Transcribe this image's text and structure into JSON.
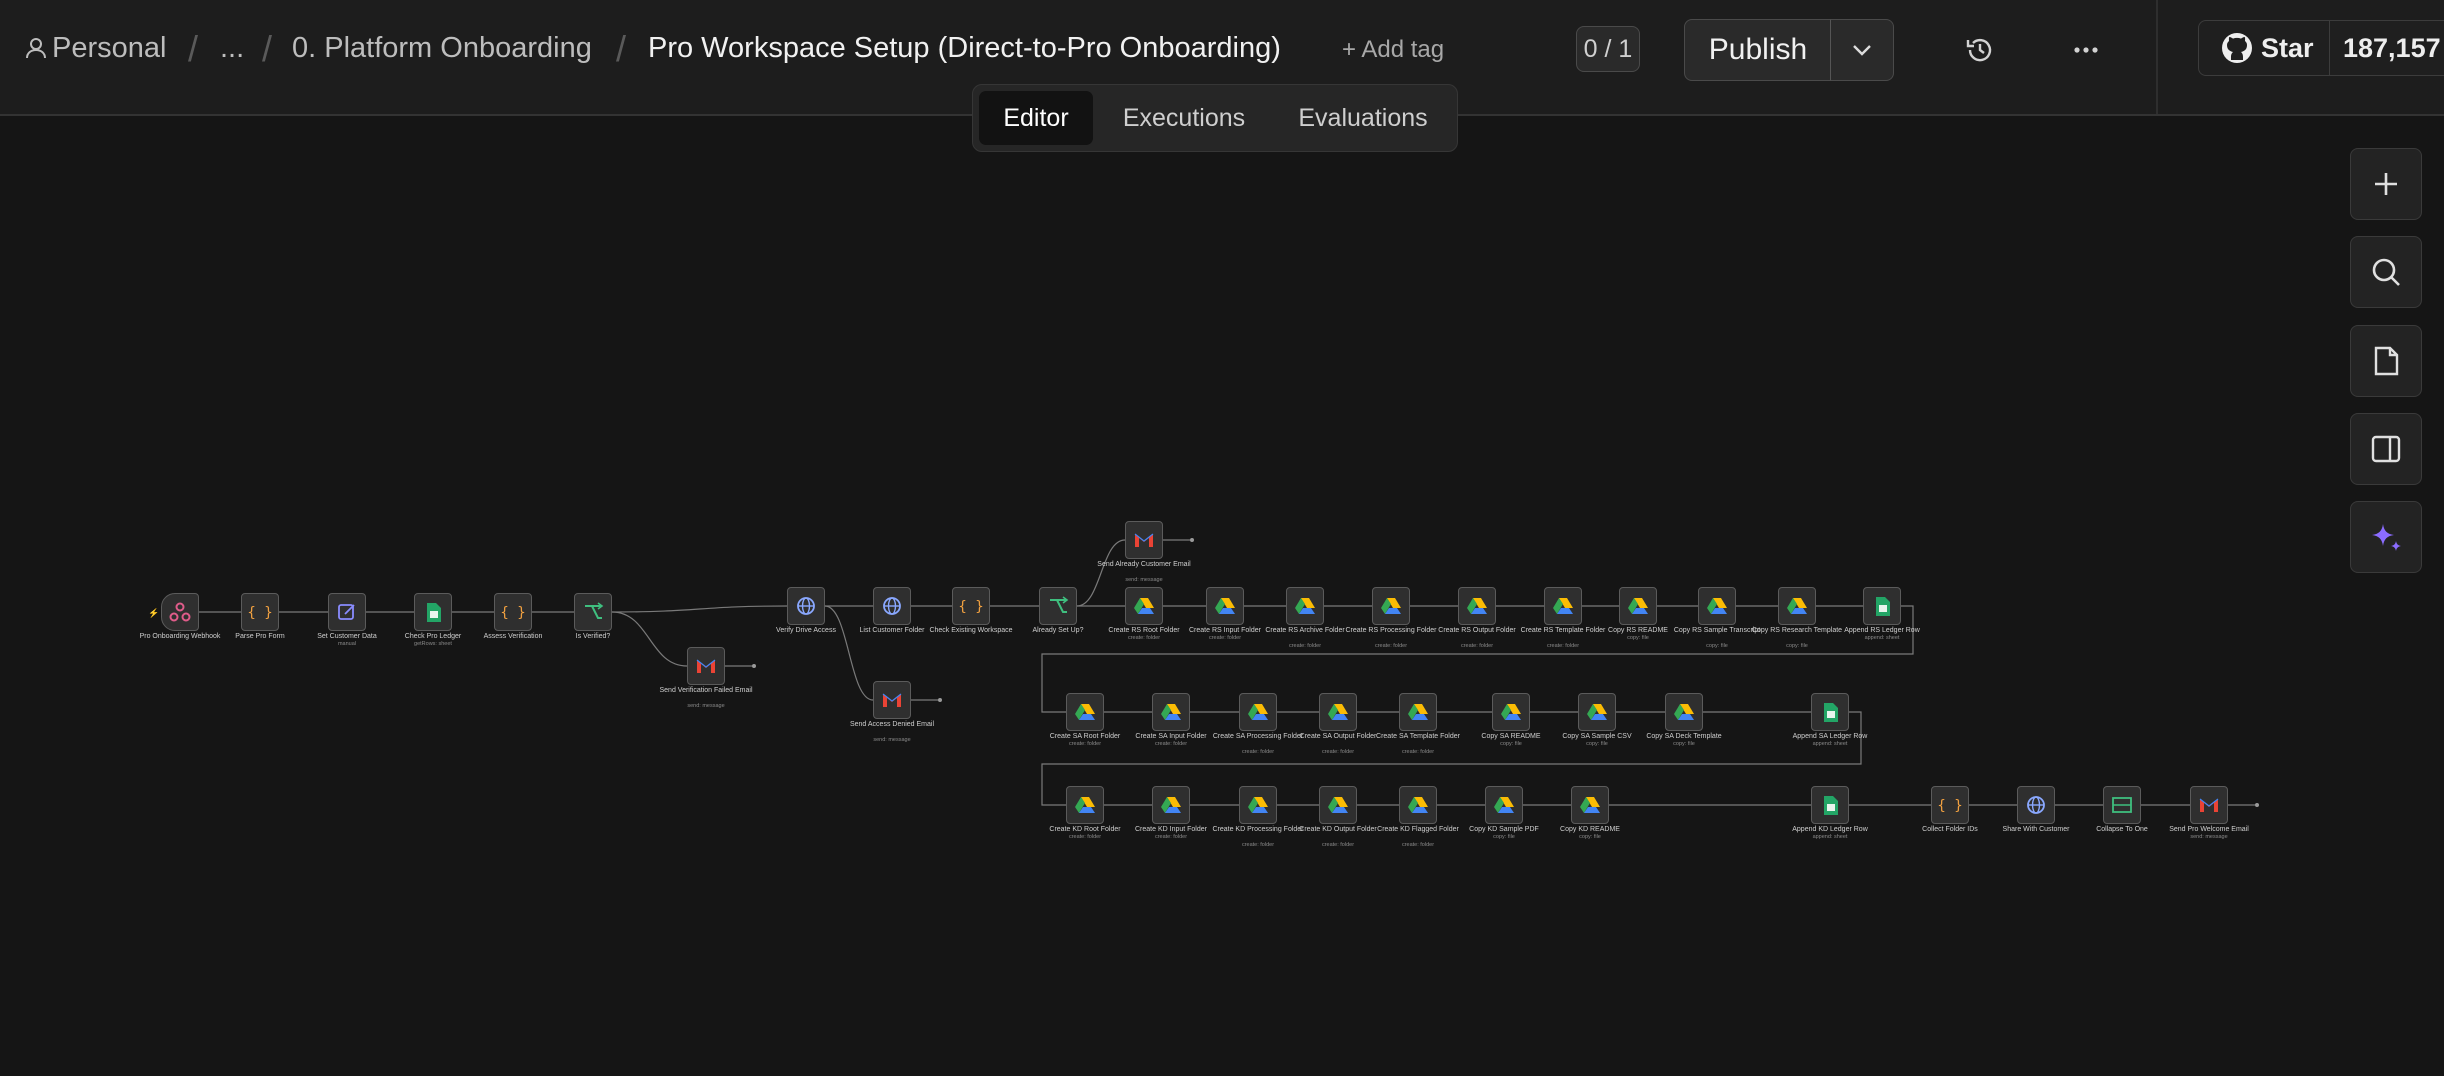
{
  "breadcrumb": {
    "owner": "Personal",
    "ellipsis": "...",
    "folder": "0. Platform Onboarding",
    "title": "Pro Workspace Setup (Direct-to-Pro Onboarding)"
  },
  "header": {
    "add_tag": "+ Add tag",
    "counter": "0 / 1",
    "publish": "Publish",
    "github_star": "Star",
    "github_count": "187,157"
  },
  "tabs": [
    "Editor",
    "Executions",
    "Evaluations"
  ],
  "active_tab": "Editor",
  "toolbar": [
    "zoom-in",
    "search",
    "sticky-note",
    "toggle-panel",
    "ai-assistant"
  ],
  "colors": {
    "accent": "#8b6cff",
    "canvas": "#151515",
    "edge": "#7a7a7a"
  },
  "nodes": [
    {
      "label": "Pro Onboarding Webhook",
      "sub": "",
      "icon": "webhook"
    },
    {
      "label": "Parse Pro Form",
      "sub": "",
      "icon": "code"
    },
    {
      "label": "Set Customer Data",
      "sub": "manual",
      "icon": "edit"
    },
    {
      "label": "Check Pro Ledger",
      "sub": "getRows: sheet",
      "icon": "sheets"
    },
    {
      "label": "Assess Verification",
      "sub": "",
      "icon": "code"
    },
    {
      "label": "Is Verified?",
      "sub": "",
      "icon": "if"
    },
    {
      "label": "Send Verification Failed Email",
      "sub": "send: message",
      "icon": "gmail"
    },
    {
      "label": "Verify Drive Access",
      "sub": "",
      "icon": "http"
    },
    {
      "label": "List Customer Folder",
      "sub": "",
      "icon": "http"
    },
    {
      "label": "Send Access Denied Email",
      "sub": "send: message",
      "icon": "gmail"
    },
    {
      "label": "Check Existing Workspace",
      "sub": "",
      "icon": "code"
    },
    {
      "label": "Already Set Up?",
      "sub": "",
      "icon": "if"
    },
    {
      "label": "Send Already Customer Email",
      "sub": "send: message",
      "icon": "gmail"
    },
    {
      "label": "Create RS Root Folder",
      "sub": "create: folder",
      "icon": "drive"
    },
    {
      "label": "Create RS Input Folder",
      "sub": "create: folder",
      "icon": "drive"
    },
    {
      "label": "Create RS Archive Folder",
      "sub": "create: folder",
      "icon": "drive"
    },
    {
      "label": "Create RS Processing Folder",
      "sub": "create: folder",
      "icon": "drive"
    },
    {
      "label": "Create RS Output Folder",
      "sub": "create: folder",
      "icon": "drive"
    },
    {
      "label": "Create RS Template Folder",
      "sub": "create: folder",
      "icon": "drive"
    },
    {
      "label": "Copy RS README",
      "sub": "copy: file",
      "icon": "drive"
    },
    {
      "label": "Copy RS Sample Transcript",
      "sub": "copy: file",
      "icon": "drive"
    },
    {
      "label": "Copy RS Research Template",
      "sub": "copy: file",
      "icon": "drive"
    },
    {
      "label": "Append RS Ledger Row",
      "sub": "append: sheet",
      "icon": "sheets"
    },
    {
      "label": "Create SA Root Folder",
      "sub": "create: folder",
      "icon": "drive"
    },
    {
      "label": "Create SA Input Folder",
      "sub": "create: folder",
      "icon": "drive"
    },
    {
      "label": "Create SA Processing Folder",
      "sub": "create: folder",
      "icon": "drive"
    },
    {
      "label": "Create SA Output Folder",
      "sub": "create: folder",
      "icon": "drive"
    },
    {
      "label": "Create SA Template Folder",
      "sub": "create: folder",
      "icon": "drive"
    },
    {
      "label": "Copy SA README",
      "sub": "copy: file",
      "icon": "drive"
    },
    {
      "label": "Copy SA Sample CSV",
      "sub": "copy: file",
      "icon": "drive"
    },
    {
      "label": "Copy SA Deck Template",
      "sub": "copy: file",
      "icon": "drive"
    },
    {
      "label": "Append SA Ledger Row",
      "sub": "append: sheet",
      "icon": "sheets"
    },
    {
      "label": "Create KD Root Folder",
      "sub": "create: folder",
      "icon": "drive"
    },
    {
      "label": "Create KD Input Folder",
      "sub": "create: folder",
      "icon": "drive"
    },
    {
      "label": "Create KD Processing Folder",
      "sub": "create: folder",
      "icon": "drive"
    },
    {
      "label": "Create KD Output Folder",
      "sub": "create: folder",
      "icon": "drive"
    },
    {
      "label": "Create KD Flagged Folder",
      "sub": "create: folder",
      "icon": "drive"
    },
    {
      "label": "Copy KD Sample PDF",
      "sub": "copy: file",
      "icon": "drive"
    },
    {
      "label": "Copy KD README",
      "sub": "copy: file",
      "icon": "drive"
    },
    {
      "label": "Append KD Ledger Row",
      "sub": "append: sheet",
      "icon": "sheets"
    },
    {
      "label": "Collect Folder IDs",
      "sub": "",
      "icon": "code"
    },
    {
      "label": "Share With Customer",
      "sub": "",
      "icon": "http"
    },
    {
      "label": "Collapse To One",
      "sub": "",
      "icon": "aggregate"
    },
    {
      "label": "Send Pro Welcome Email",
      "sub": "send: message",
      "icon": "gmail"
    }
  ]
}
